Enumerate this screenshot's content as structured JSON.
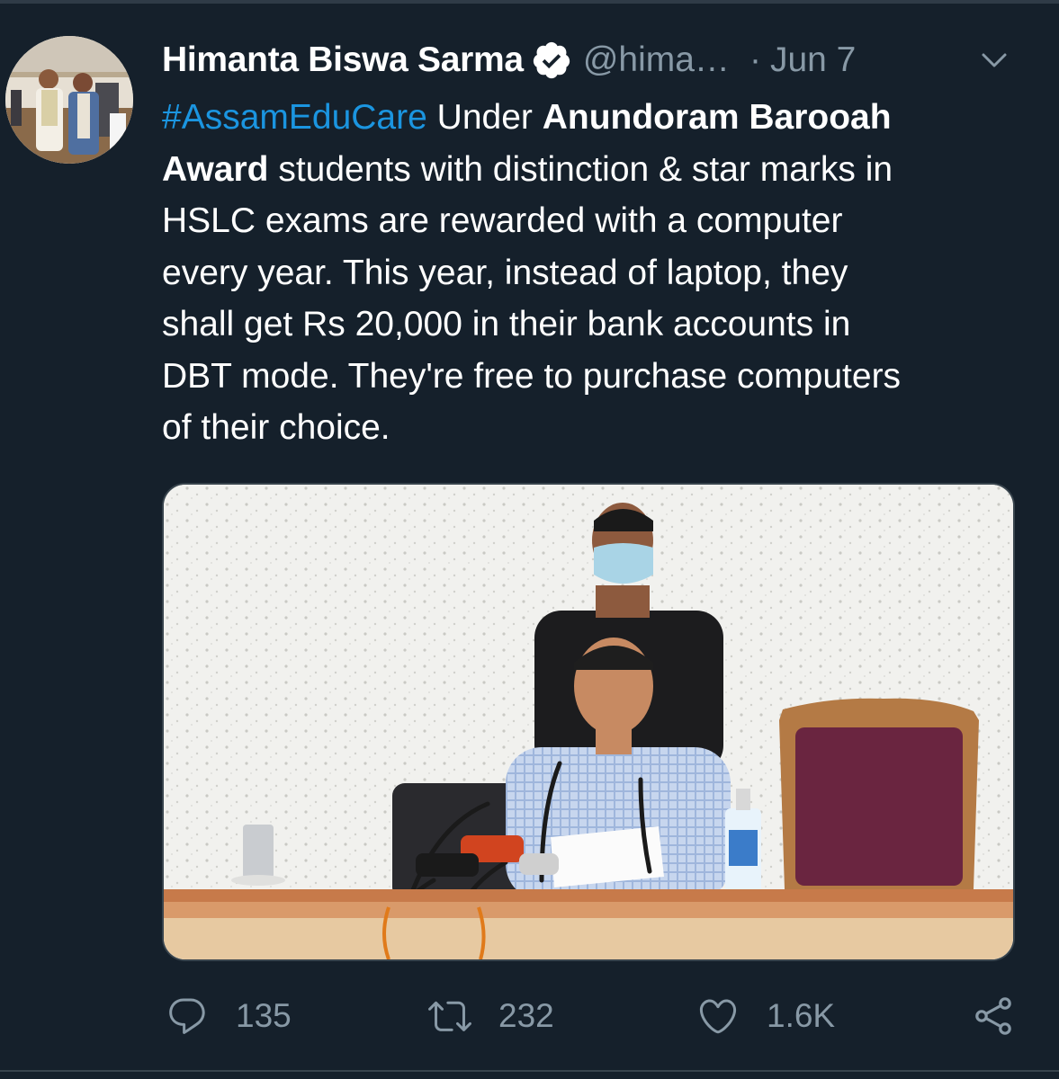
{
  "tweet": {
    "author": {
      "display_name": "Himanta Biswa Sarma",
      "handle": "@hima…",
      "verified_icon": "verified-badge-icon"
    },
    "separator": "·",
    "date": "Jun 7",
    "text": {
      "hashtag": "#AssamEduCare",
      "line1_rest": " Under ",
      "line1_bold": "Anundoram Barooah",
      "line2_bold": "Award",
      "line2_rest": " students with distinction & star marks in",
      "line3": "HSLC exams are rewarded with a computer",
      "line4": "every year. This year, instead of laptop, they",
      "line5": "shall get Rs 20,000 in their bank accounts in",
      "line6": "DBT mode. They're free to purchase computers",
      "line7": "of their choice."
    },
    "actions": {
      "replies": "135",
      "retweets": "232",
      "likes": "1.6K"
    }
  },
  "colors": {
    "background": "#15202b",
    "link": "#1b95e0",
    "muted": "#8899a6",
    "border": "#38444d"
  }
}
